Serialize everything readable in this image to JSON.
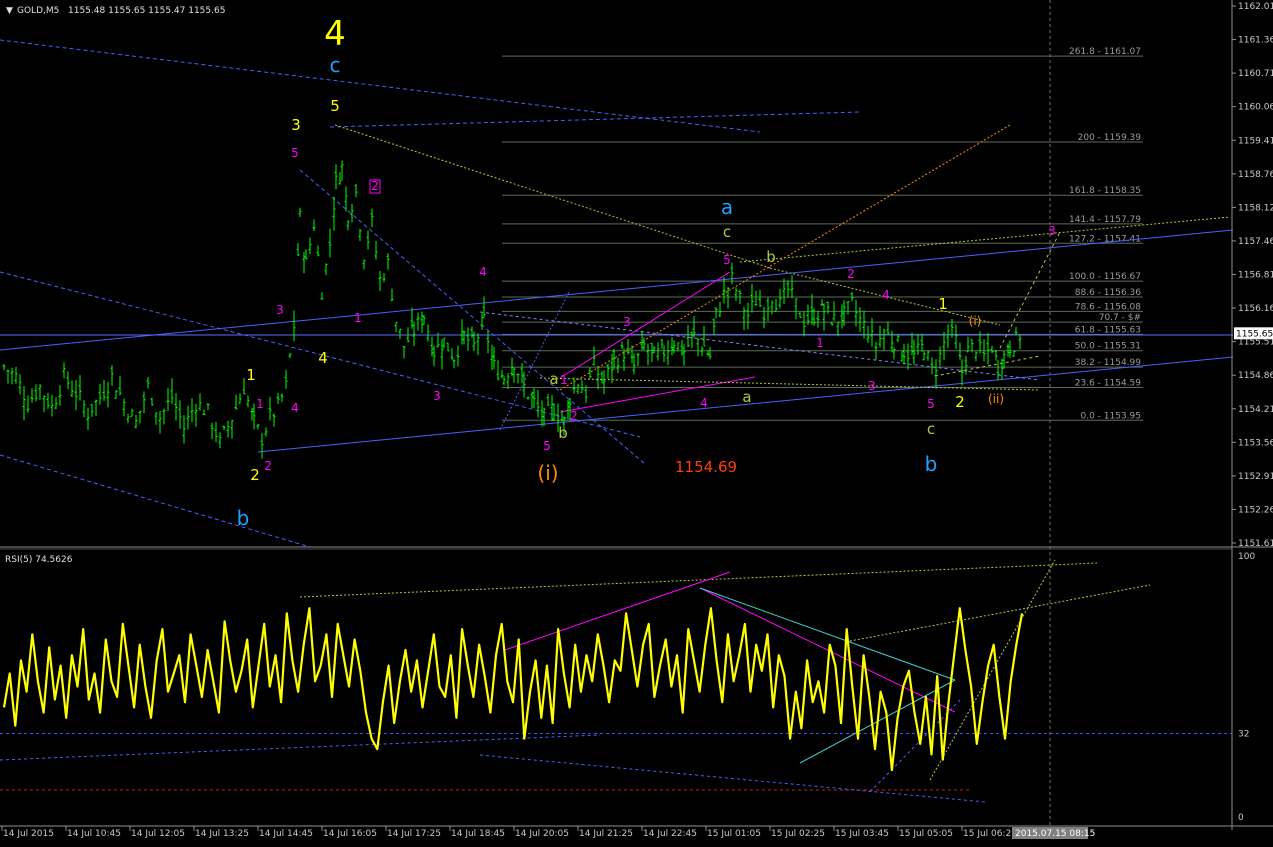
{
  "window": {
    "symbol_title": "GOLD,M5",
    "ohlc": "1155.48 1155.65 1155.47 1155.65",
    "indicator_title": "RSI(5) 74.5626"
  },
  "colors": {
    "background": "#000000",
    "candles": "#00ff00",
    "rsi_line": "#ffff00",
    "grid": "#1e1e1e",
    "axis_text": "#c8c8c8",
    "wave_yellow": "#ffff00",
    "wave_cyan": "#1ea0ff",
    "wave_magenta": "#ff00ff",
    "wave_olive": "#b4c83c",
    "wave_orange": "#ff8c00",
    "price_label_red": "#ff3c14",
    "trendline_blue": "#4860ff",
    "fib_line": "#5a6e5a"
  },
  "chart_data": [
    {
      "type": "candlestick",
      "title": "GOLD,M5",
      "ohlc_header": "1155.48 1155.65 1155.47 1155.65",
      "ylim": [
        1151.55,
        1162.05
      ],
      "y_ticks": [
        "1162.01",
        "1161.36",
        "1160.71",
        "1160.06",
        "1159.41",
        "1158.76",
        "1158.12",
        "1157.46",
        "1156.81",
        "1156.16",
        "1155.51",
        "1154.86",
        "1154.21",
        "1153.56",
        "1152.91",
        "1152.26",
        "1151.61"
      ],
      "current_price": "1155.65",
      "x_ticks": [
        "14 Jul 2015",
        "14 Jul 10:45",
        "14 Jul 12:05",
        "14 Jul 13:25",
        "14 Jul 14:45",
        "14 Jul 16:05",
        "14 Jul 17:25",
        "14 Jul 18:45",
        "14 Jul 20:05",
        "14 Jul 21:25",
        "14 Jul 22:45",
        "15 Jul 01:05",
        "15 Jul 02:25",
        "15 Jul 03:45",
        "15 Jul 05:05",
        "15 Jul 06:25"
      ],
      "cursor_time": "2015.07.15 08:15",
      "close_path": [
        [
          0,
          1155.0
        ],
        [
          12,
          1154.8
        ],
        [
          24,
          1154.3
        ],
        [
          36,
          1154.6
        ],
        [
          48,
          1154.2
        ],
        [
          60,
          1154.8
        ],
        [
          72,
          1154.5
        ],
        [
          84,
          1154.1
        ],
        [
          96,
          1154.4
        ],
        [
          108,
          1154.8
        ],
        [
          120,
          1154.3
        ],
        [
          132,
          1153.9
        ],
        [
          144,
          1154.6
        ],
        [
          156,
          1154.0
        ],
        [
          168,
          1154.4
        ],
        [
          180,
          1153.8
        ],
        [
          192,
          1154.3
        ],
        [
          204,
          1154.1
        ],
        [
          216,
          1153.5
        ],
        [
          228,
          1154.0
        ],
        [
          240,
          1154.6
        ],
        [
          250,
          1153.9
        ],
        [
          258,
          1153.6
        ],
        [
          266,
          1154.0
        ],
        [
          274,
          1154.2
        ],
        [
          282,
          1154.6
        ],
        [
          290,
          1155.8
        ],
        [
          296,
          1157.9
        ],
        [
          302,
          1157.0
        ],
        [
          310,
          1157.8
        ],
        [
          318,
          1156.5
        ],
        [
          326,
          1157.4
        ],
        [
          332,
          1158.6
        ],
        [
          338,
          1158.9
        ],
        [
          344,
          1158.0
        ],
        [
          352,
          1158.4
        ],
        [
          360,
          1157.2
        ],
        [
          368,
          1157.8
        ],
        [
          376,
          1156.7
        ],
        [
          384,
          1157.0
        ],
        [
          392,
          1155.9
        ],
        [
          400,
          1155.4
        ],
        [
          410,
          1155.7
        ],
        [
          420,
          1156.0
        ],
        [
          430,
          1155.3
        ],
        [
          440,
          1155.5
        ],
        [
          450,
          1155.2
        ],
        [
          460,
          1155.6
        ],
        [
          470,
          1155.4
        ],
        [
          480,
          1155.9
        ],
        [
          490,
          1155.0
        ],
        [
          500,
          1154.8
        ],
        [
          510,
          1155.1
        ],
        [
          520,
          1154.6
        ],
        [
          530,
          1154.3
        ],
        [
          540,
          1154.0
        ],
        [
          550,
          1154.2
        ],
        [
          560,
          1153.9
        ],
        [
          566,
          1154.4
        ],
        [
          574,
          1154.7
        ],
        [
          582,
          1154.5
        ],
        [
          590,
          1155.0
        ],
        [
          600,
          1154.7
        ],
        [
          610,
          1155.1
        ],
        [
          620,
          1155.3
        ],
        [
          630,
          1155.0
        ],
        [
          640,
          1155.4
        ],
        [
          650,
          1155.2
        ],
        [
          660,
          1155.3
        ],
        [
          670,
          1155.5
        ],
        [
          680,
          1155.3
        ],
        [
          690,
          1155.6
        ],
        [
          700,
          1155.4
        ],
        [
          706,
          1155.2
        ],
        [
          712,
          1156.0
        ],
        [
          720,
          1156.4
        ],
        [
          728,
          1156.7
        ],
        [
          736,
          1156.3
        ],
        [
          744,
          1156.0
        ],
        [
          752,
          1156.3
        ],
        [
          760,
          1156.1
        ],
        [
          768,
          1156.4
        ],
        [
          776,
          1156.2
        ],
        [
          784,
          1156.5
        ],
        [
          792,
          1156.2
        ],
        [
          800,
          1155.9
        ],
        [
          810,
          1156.0
        ],
        [
          820,
          1156.1
        ],
        [
          830,
          1155.9
        ],
        [
          840,
          1156.0
        ],
        [
          848,
          1156.2
        ],
        [
          856,
          1155.9
        ],
        [
          864,
          1155.7
        ],
        [
          872,
          1155.4
        ],
        [
          880,
          1155.7
        ],
        [
          890,
          1155.5
        ],
        [
          900,
          1155.3
        ],
        [
          910,
          1155.2
        ],
        [
          920,
          1155.4
        ],
        [
          928,
          1154.9
        ],
        [
          936,
          1155.2
        ],
        [
          944,
          1155.7
        ],
        [
          952,
          1155.5
        ],
        [
          958,
          1154.9
        ],
        [
          964,
          1155.3
        ],
        [
          972,
          1155.4
        ],
        [
          980,
          1155.2
        ],
        [
          988,
          1155.4
        ],
        [
          994,
          1155.0
        ],
        [
          1000,
          1155.2
        ],
        [
          1006,
          1155.4
        ],
        [
          1012,
          1155.5
        ],
        [
          1018,
          1155.7
        ]
      ],
      "fibonacci_levels": [
        {
          "label": "261.8 - 1161.07",
          "price": 1161.07
        },
        {
          "label": "200 - 1159.39",
          "price": 1159.39
        },
        {
          "label": "161.8 - 1158.35",
          "price": 1158.35
        },
        {
          "label": "141.4 - 1157.79",
          "price": 1157.79
        },
        {
          "label": "127.2 - 1157.41",
          "price": 1157.41
        },
        {
          "label": "100.0 - 1156.67",
          "price": 1156.67
        },
        {
          "label": "88.6 - 1156.36",
          "price": 1156.36
        },
        {
          "label": "78.6 - 1156.08",
          "price": 1156.08
        },
        {
          "label": "70.7 - $#",
          "price": 1155.87
        },
        {
          "label": "61.8 - 1155.63",
          "price": 1155.63
        },
        {
          "label": "50.0 - 1155.31",
          "price": 1155.31
        },
        {
          "label": "38.2 - 1154.99",
          "price": 1154.99
        },
        {
          "label": "23.6 - 1154.59",
          "price": 1154.59
        },
        {
          "label": "0.0 - 1153.95",
          "price": 1153.95
        }
      ],
      "annotations": {
        "price_note": "1154.69",
        "wave_labels": [
          {
            "text": "4",
            "color": "yellow",
            "size": "xl"
          },
          {
            "text": "c",
            "color": "cyan",
            "size": "l"
          },
          {
            "text": "5",
            "color": "yellow",
            "size": "m"
          },
          {
            "text": "3",
            "color": "yellow",
            "size": "m"
          },
          {
            "text": "5",
            "color": "magenta",
            "size": "s"
          },
          {
            "text": "2",
            "color": "magenta",
            "size": "s",
            "boxed": true
          },
          {
            "text": "4",
            "color": "magenta",
            "size": "s"
          },
          {
            "text": "3",
            "color": "magenta",
            "size": "s"
          },
          {
            "text": "1",
            "color": "magenta",
            "size": "s"
          },
          {
            "text": "4",
            "color": "yellow",
            "size": "m"
          },
          {
            "text": "1",
            "color": "yellow",
            "size": "m"
          },
          {
            "text": "1",
            "color": "magenta",
            "size": "s"
          },
          {
            "text": "4",
            "color": "magenta",
            "size": "s"
          },
          {
            "text": "2",
            "color": "yellow",
            "size": "m"
          },
          {
            "text": "2",
            "color": "magenta",
            "size": "s"
          },
          {
            "text": "b",
            "color": "cyan",
            "size": "l"
          },
          {
            "text": "3",
            "color": "magenta",
            "size": "s"
          },
          {
            "text": "a",
            "color": "olive",
            "size": "m"
          },
          {
            "text": "1",
            "color": "magenta",
            "size": "s"
          },
          {
            "text": "2",
            "color": "magenta",
            "size": "s"
          },
          {
            "text": "b",
            "color": "olive",
            "size": "m"
          },
          {
            "text": "5",
            "color": "magenta",
            "size": "s"
          },
          {
            "text": "(i)",
            "color": "orange",
            "size": "l"
          },
          {
            "text": "3",
            "color": "magenta",
            "size": "s"
          },
          {
            "text": "4",
            "color": "magenta",
            "size": "s"
          },
          {
            "text": "a",
            "color": "cyan",
            "size": "l"
          },
          {
            "text": "c",
            "color": "olive",
            "size": "m"
          },
          {
            "text": "5",
            "color": "magenta",
            "size": "s"
          },
          {
            "text": "b",
            "color": "olive",
            "size": "m"
          },
          {
            "text": "a",
            "color": "olive",
            "size": "m"
          },
          {
            "text": "1",
            "color": "magenta",
            "size": "s"
          },
          {
            "text": "2",
            "color": "magenta",
            "size": "s"
          },
          {
            "text": "4",
            "color": "magenta",
            "size": "s"
          },
          {
            "text": "3",
            "color": "magenta",
            "size": "s"
          },
          {
            "text": "5",
            "color": "magenta",
            "size": "s"
          },
          {
            "text": "c",
            "color": "olive",
            "size": "m"
          },
          {
            "text": "b",
            "color": "cyan",
            "size": "l"
          },
          {
            "text": "1",
            "color": "yellow",
            "size": "m"
          },
          {
            "text": "2",
            "color": "yellow",
            "size": "m"
          },
          {
            "text": "(i)",
            "color": "orange",
            "size": "s"
          },
          {
            "text": "(ii)",
            "color": "orange",
            "size": "s"
          },
          {
            "text": "3",
            "color": "magenta",
            "size": "s"
          }
        ]
      }
    },
    {
      "type": "line",
      "title": "RSI(5) 74.5626",
      "ylim": [
        0,
        100
      ],
      "y_ticks": [
        "100",
        "32",
        "0"
      ],
      "level": 32,
      "series": [
        {
          "name": "RSI(5)",
          "values": [
            42,
            55,
            35,
            60,
            48,
            70,
            52,
            40,
            65,
            45,
            58,
            38,
            62,
            50,
            72,
            45,
            55,
            40,
            68,
            52,
            46,
            74,
            58,
            42,
            66,
            50,
            38,
            60,
            72,
            48,
            55,
            62,
            44,
            70,
            58,
            46,
            64,
            52,
            40,
            75,
            60,
            48,
            56,
            68,
            42,
            58,
            74,
            50,
            62,
            44,
            78,
            60,
            48,
            66,
            80,
            52,
            58,
            70,
            46,
            74,
            62,
            50,
            68,
            56,
            40,
            30,
            26,
            44,
            58,
            36,
            52,
            64,
            48,
            60,
            42,
            56,
            70,
            50,
            46,
            62,
            38,
            72,
            58,
            46,
            66,
            54,
            40,
            62,
            74,
            52,
            44,
            68,
            30,
            48,
            60,
            38,
            58,
            36,
            72,
            55,
            42,
            66,
            48,
            62,
            52,
            70,
            58,
            44,
            60,
            56,
            78,
            64,
            50,
            66,
            74,
            46,
            58,
            68,
            50,
            62,
            40,
            72,
            60,
            48,
            66,
            80,
            60,
            44,
            70,
            52,
            62,
            74,
            48,
            66,
            56,
            70,
            42,
            62,
            54,
            30,
            48,
            34,
            60,
            44,
            52,
            40,
            66,
            58,
            36,
            72,
            50,
            30,
            62,
            46,
            26,
            48,
            40,
            18,
            38,
            50,
            56,
            40,
            28,
            46,
            24,
            54,
            22,
            44,
            62,
            80,
            64,
            50,
            28,
            44,
            58,
            66,
            46,
            30,
            52,
            66,
            78
          ]
        }
      ]
    }
  ]
}
